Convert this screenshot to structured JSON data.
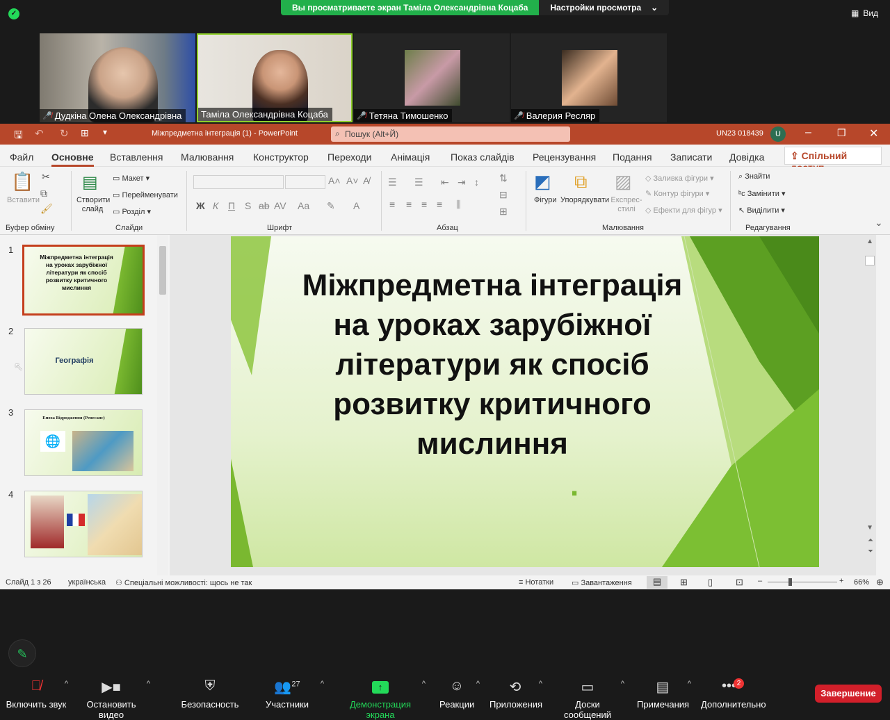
{
  "zoom": {
    "share_banner": "Вы просматриваете экран Таміла Олександрівна Коцаба",
    "view_options": "Настройки просмотра",
    "view_button": "Вид",
    "participants_tiles": [
      {
        "name": "Дудкіна Олена Олександрівна"
      },
      {
        "name": "Таміла Олександрівна Коцаба"
      },
      {
        "name": "Тетяна Тимошенко"
      },
      {
        "name": "Валерия Ресляр"
      }
    ],
    "bottom": {
      "mute": "Включить звук",
      "video": "Остановить видео",
      "security": "Безопасность",
      "participants": "Участники",
      "participants_count": "27",
      "share": "Демонстрация экрана",
      "reactions": "Реакции",
      "apps": "Приложения",
      "whiteboards": "Доски сообщений",
      "notes": "Примечания",
      "more": "Дополнительно",
      "more_badge": "2",
      "end": "Завершение"
    }
  },
  "ppt": {
    "title": "Міжпредметна інтеграція (1)  -  PowerPoint",
    "search": "Пошук (Alt+Й)",
    "account": "UN23 018439",
    "avatar": "U",
    "tabs": [
      "Файл",
      "Основне",
      "Вставлення",
      "Малювання",
      "Конструктор",
      "Переходи",
      "Анімація",
      "Показ слайдів",
      "Рецензування",
      "Подання",
      "Записати",
      "Довідка"
    ],
    "share": "Спільний доступ",
    "ribbon": {
      "paste": "Вставити",
      "clipboard": "Буфер обміну",
      "new_slide": "Створити слайд",
      "layout": "Макет",
      "rename": "Перейменувати",
      "section": "Розділ",
      "slides": "Слайди",
      "font": "Шрифт",
      "paragraph": "Абзац",
      "shapes": "Фігури",
      "arrange": "Упорядкувати",
      "quick_styles": "Експрес-стилі",
      "shape_fill": "Заливка фігури",
      "shape_outline": "Контур фігури",
      "shape_effects": "Ефекти для фігур",
      "drawing": "Малювання",
      "find": "Знайти",
      "replace": "Замінити",
      "select": "Виділити",
      "editing": "Редагування"
    },
    "thumbnails": [
      {
        "num": "1",
        "text": "Міжпредметна інтеграція на уроках зарубіжної літератури як спосіб розвитку критичного мислиння"
      },
      {
        "num": "2",
        "text": "Географія"
      },
      {
        "num": "3",
        "text": "Епоха Відродження (Ренесанс)"
      },
      {
        "num": "4",
        "text": ""
      }
    ],
    "slide_title": "Міжпредметна інтеграція на уроках зарубіжної літератури як спосіб розвитку критичного мислиння",
    "status": {
      "slide": "Слайд 1 з 26",
      "lang": "українська",
      "accessibility": "Спеціальні можливості: щось не так",
      "notes": "Нотатки",
      "download": "Завантаження",
      "zoom": "66%"
    }
  }
}
